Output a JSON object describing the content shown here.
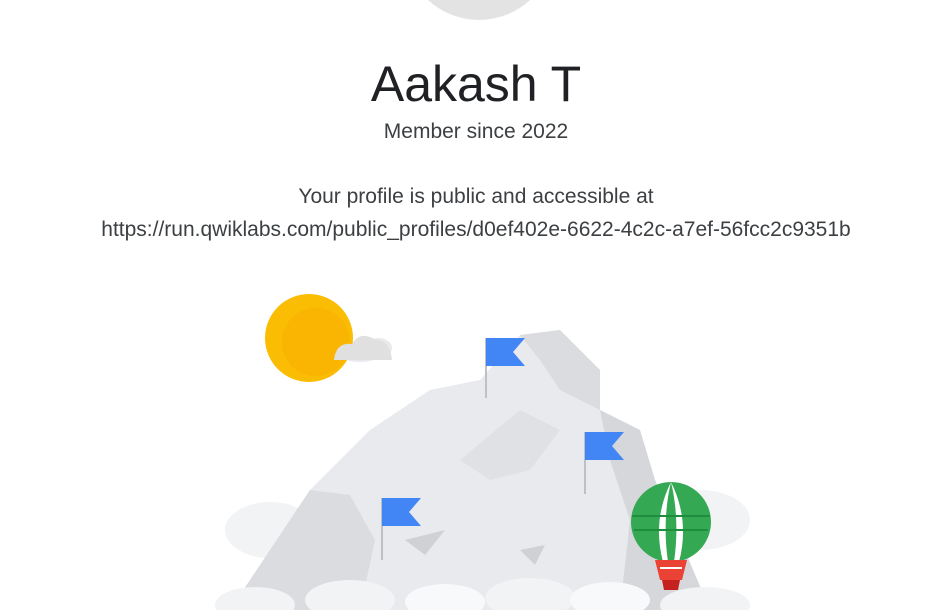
{
  "profile": {
    "name": "Aakash T",
    "member_since": "Member since 2022",
    "public_notice": "Your profile is public and accessible at",
    "public_url": "https://run.qwiklabs.com/public_profiles/d0ef402e-6622-4c2c-a7ef-56fcc2c9351b"
  },
  "illustration": {
    "icon": "mountain-flags-illustration",
    "colors": {
      "sun": "#fbbc04",
      "flag": "#4285f4",
      "balloon_green": "#34a853",
      "balloon_red": "#ea4335",
      "mountain": "#e8eaed",
      "mountain_shadow": "#dadce0",
      "cloud": "#f1f3f4"
    }
  }
}
